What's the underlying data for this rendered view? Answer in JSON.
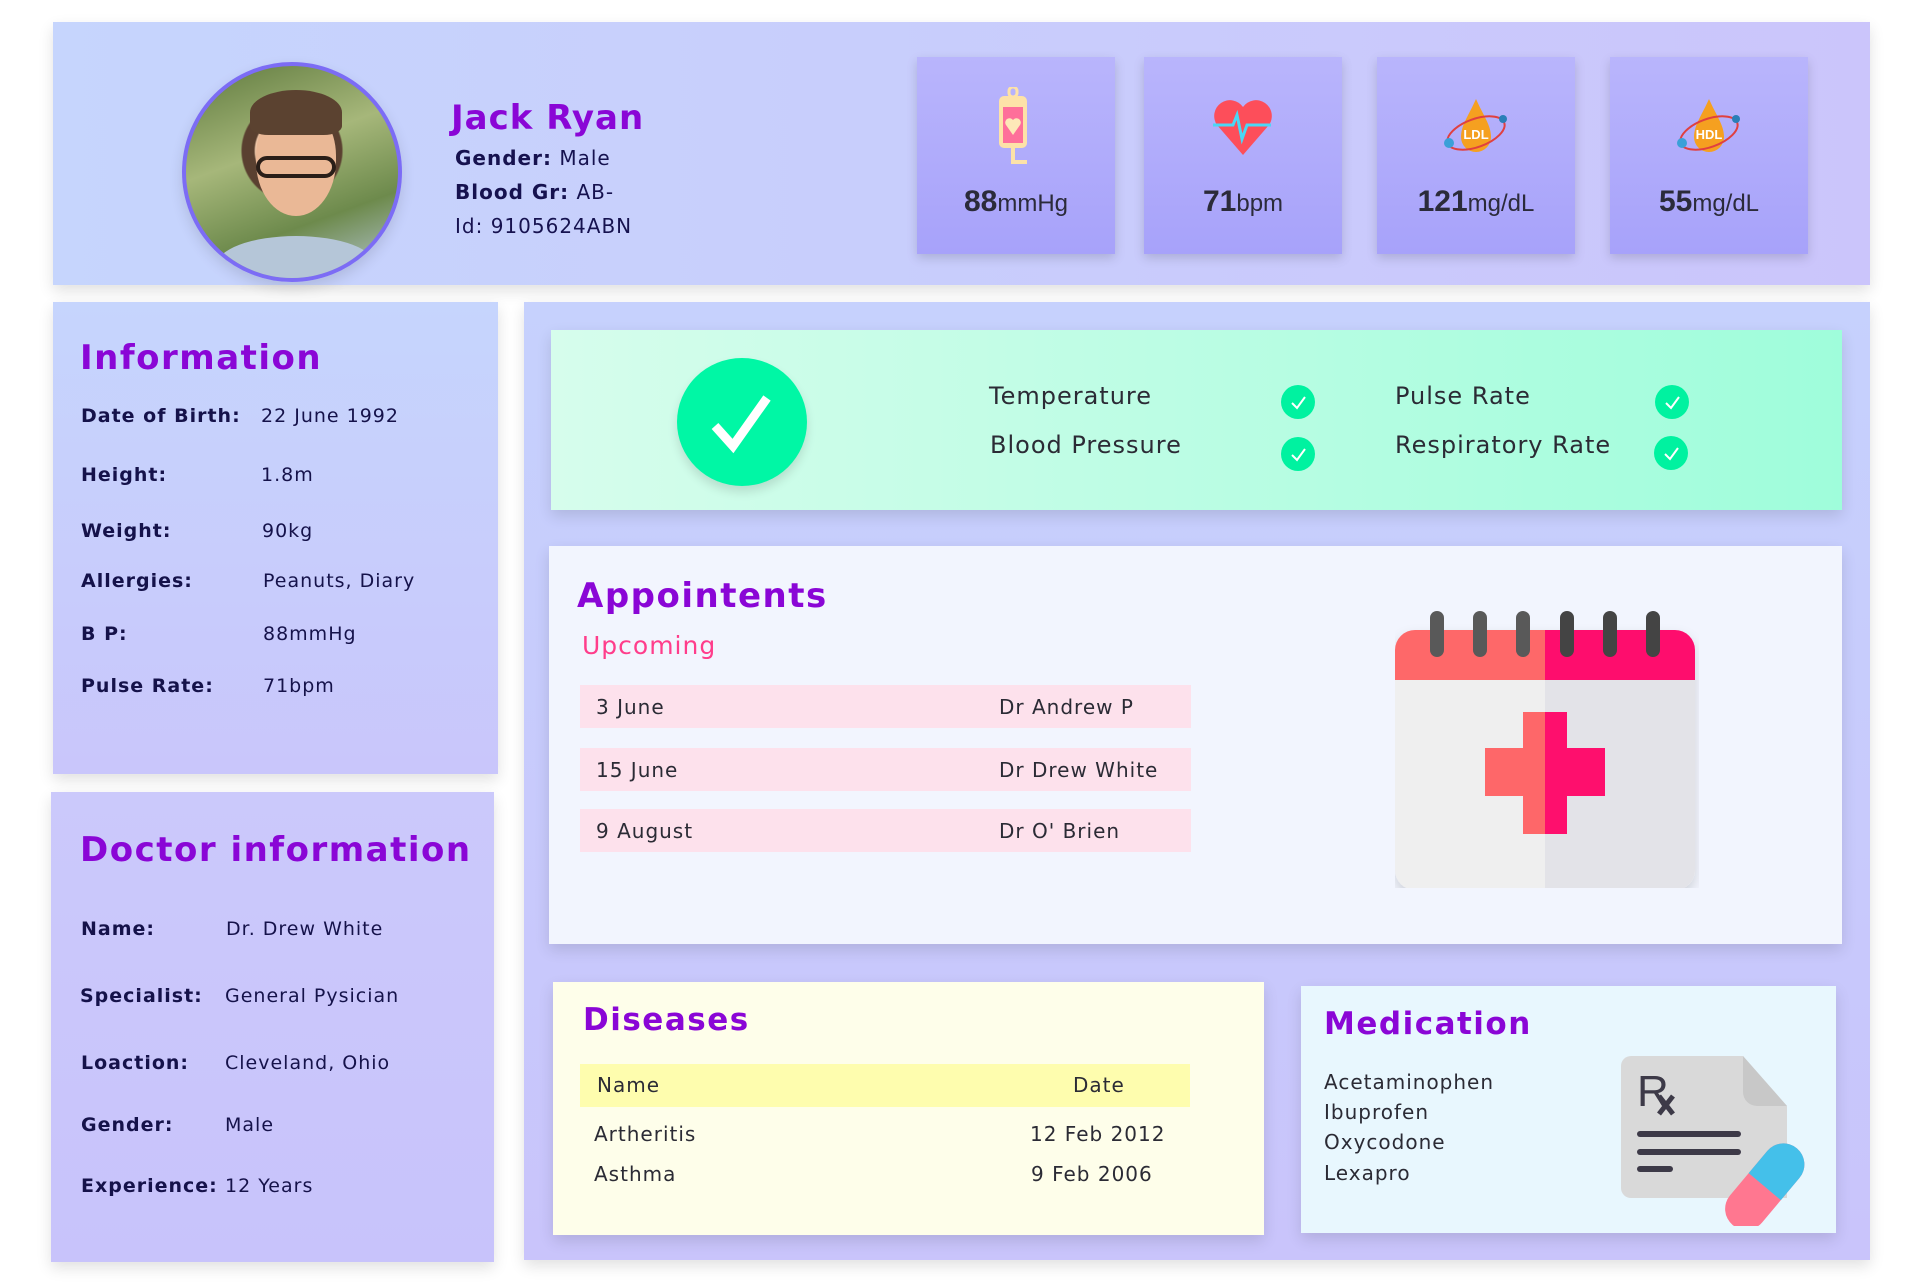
{
  "patient": {
    "name": "Jack Ryan",
    "gender_label": "Gender:",
    "gender": "Male",
    "blood_label": "Blood Gr:",
    "blood": "AB-",
    "id_text": "Id: 9105624ABN"
  },
  "vitals": [
    {
      "icon": "blood-bag-icon",
      "value": "88",
      "unit": "mmHg"
    },
    {
      "icon": "heart-pulse-icon",
      "value": "71",
      "unit": "bpm"
    },
    {
      "icon": "ldl-drop-icon",
      "value": "121",
      "unit": "mg/dL"
    },
    {
      "icon": "hdl-drop-icon",
      "value": "55",
      "unit": "mg/dL"
    }
  ],
  "information": {
    "title": "Information",
    "rows": [
      {
        "label": "Date of Birth:",
        "value": "22 June 1992"
      },
      {
        "label": "Height:",
        "value": "1.8m"
      },
      {
        "label": "Weight:",
        "value": "90kg"
      },
      {
        "label": "Allergies:",
        "value": "Peanuts, Diary"
      },
      {
        "label": "B P:",
        "value": "88mmHg"
      },
      {
        "label": "Pulse Rate:",
        "value": "71bpm"
      }
    ]
  },
  "doctor": {
    "title": "Doctor information",
    "rows": [
      {
        "label": "Name:",
        "value": "Dr. Drew White"
      },
      {
        "label": "Specialist:",
        "value": "General Pysician"
      },
      {
        "label": "Loaction:",
        "value": "Cleveland, Ohio"
      },
      {
        "label": "Gender:",
        "value": "Male"
      },
      {
        "label": "Experience:",
        "value": "12 Years"
      }
    ]
  },
  "status": {
    "items": [
      "Temperature",
      "Blood Pressure",
      "Pulse Rate",
      "Respiratory Rate"
    ],
    "all_ok": true
  },
  "appointments": {
    "title": "Appointents",
    "subtitle": "Upcoming",
    "rows": [
      {
        "date": "3 June",
        "doctor": "Dr Andrew P"
      },
      {
        "date": "15 June",
        "doctor": "Dr Drew White"
      },
      {
        "date": "9 August",
        "doctor": "Dr O' Brien"
      }
    ]
  },
  "diseases": {
    "title": "Diseases",
    "headers": [
      "Name",
      "Date"
    ],
    "rows": [
      {
        "name": "Artheritis",
        "date": "12 Feb 2012"
      },
      {
        "name": "Asthma",
        "date": "9 Feb 2006"
      }
    ]
  },
  "medication": {
    "title": "Medication",
    "items": [
      "Acetaminophen",
      "Ibuprofen",
      "Oxycodone",
      "Lexapro"
    ]
  },
  "colors": {
    "accent": "#8a06d6",
    "upcoming": "#ff3d8b",
    "ok": "#00f7a5"
  }
}
